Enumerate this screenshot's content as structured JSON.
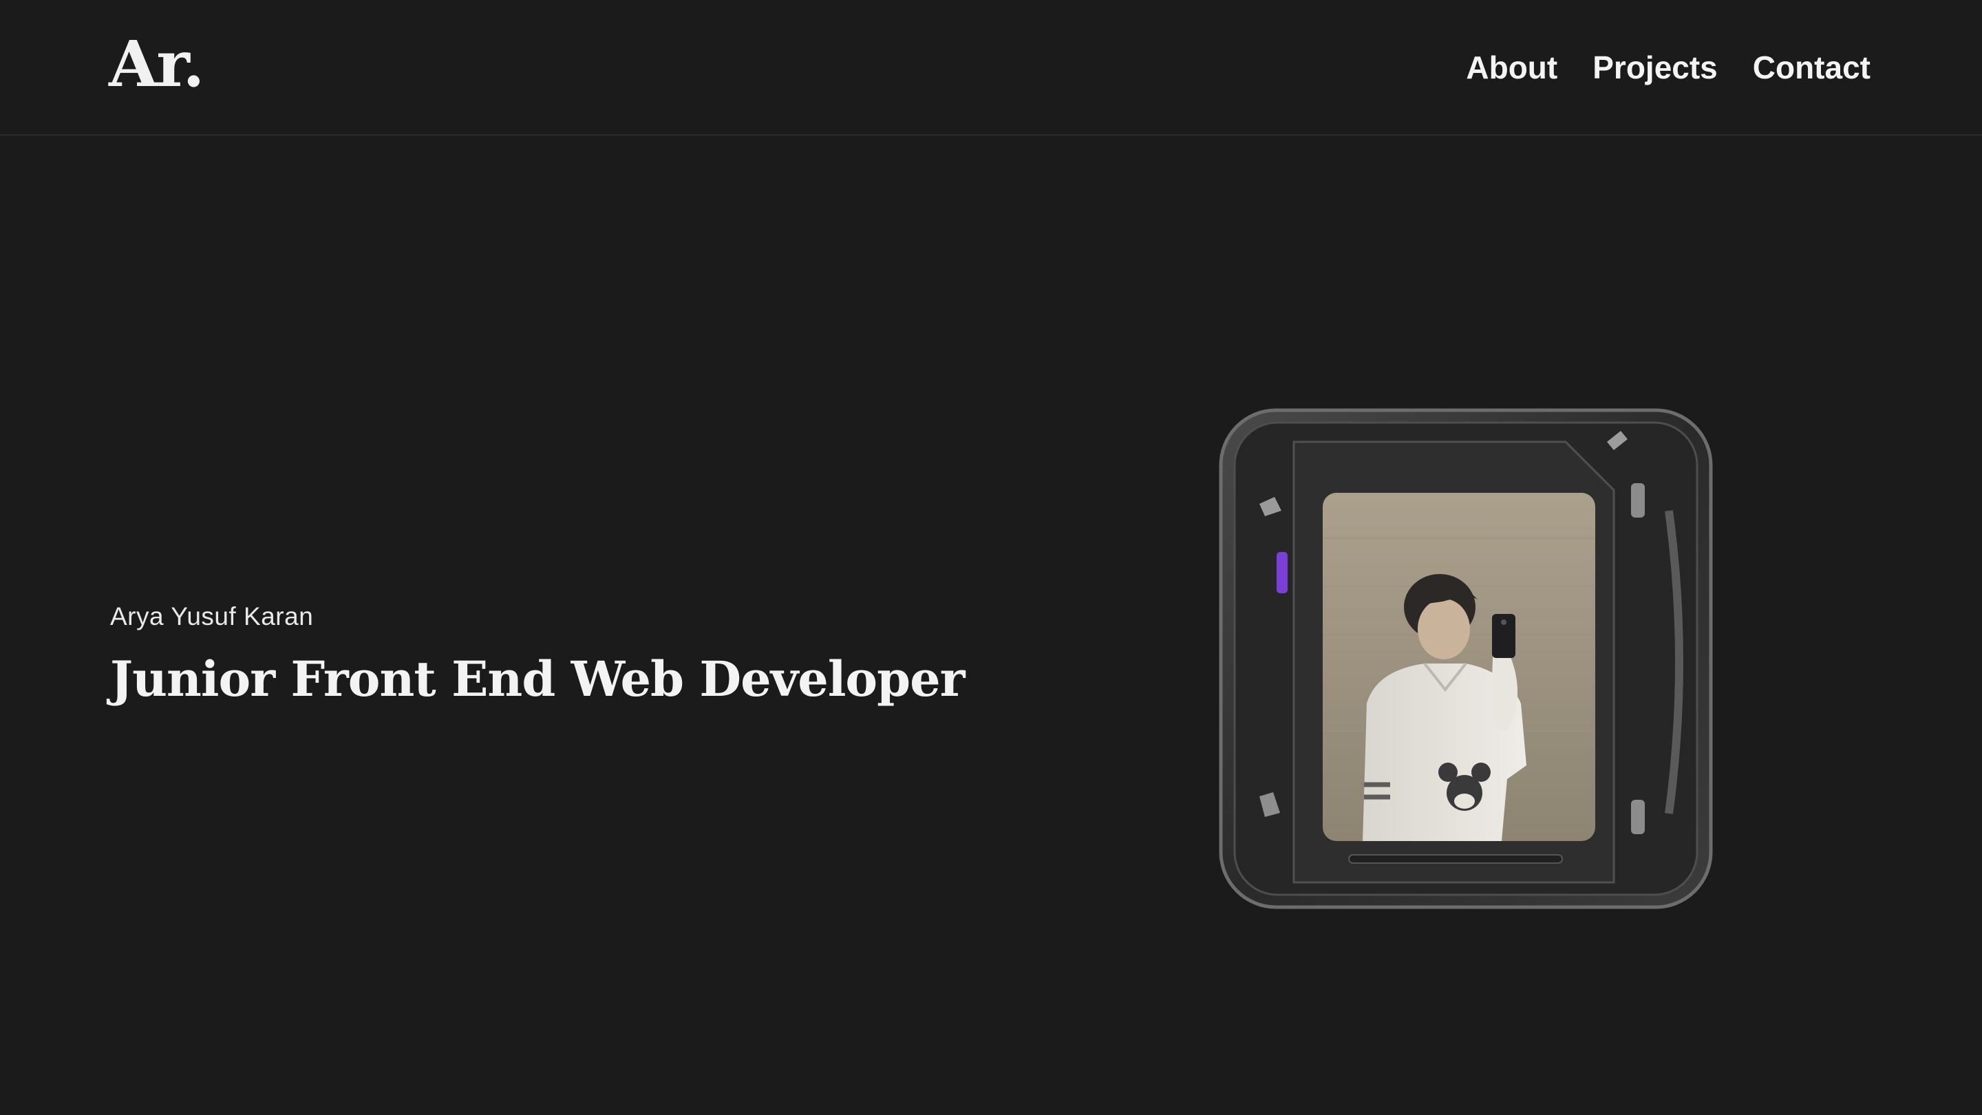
{
  "header": {
    "logo": "Ar.",
    "nav": [
      {
        "label": "About"
      },
      {
        "label": "Projects"
      },
      {
        "label": "Contact"
      }
    ]
  },
  "hero": {
    "name": "Arya Yusuf Karan",
    "role": "Junior Front End Web Developer"
  },
  "colors": {
    "background": "#1b1b1b",
    "text": "#f3f3f3",
    "accent": "#7a3fd6"
  }
}
